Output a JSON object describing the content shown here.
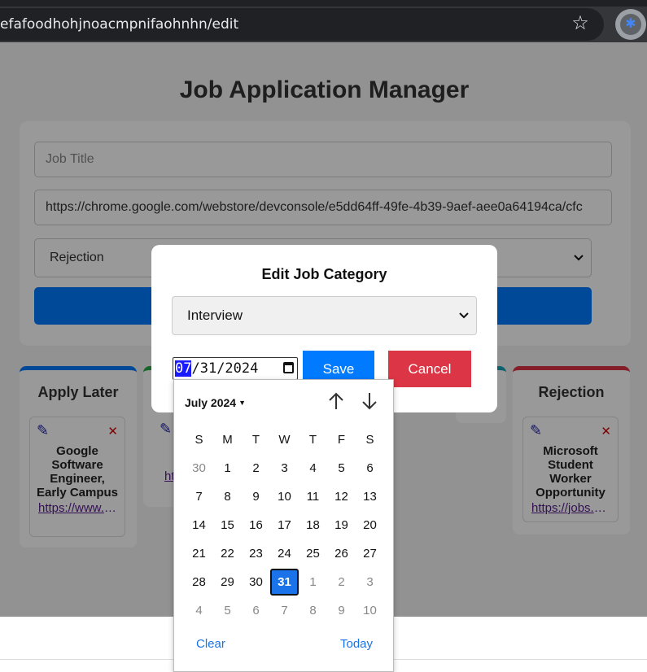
{
  "browser": {
    "url": "efafoodhohjnoacmpnifaohnhn/edit"
  },
  "page": {
    "title": "Job Application Manager",
    "form": {
      "job_title_placeholder": "Job Title",
      "url_value": "https://chrome.google.com/webstore/devconsole/e5dd64ff-49fe-4b39-9aef-aee0a64194ca/cfc",
      "category_value": "Rejection"
    },
    "columns": [
      {
        "title": "Apply Later",
        "color": "#007bff",
        "jobs": [
          {
            "name": "Google Software Engineer, Early Campus",
            "link": "https://www.google.com"
          }
        ]
      },
      {
        "title": "Rejection",
        "color": "#dc3545",
        "jobs": [
          {
            "name": "Microsoft Student Worker Opportunity",
            "link": "https://jobs.microsoft.com"
          }
        ]
      }
    ],
    "partial_column": {
      "link": "ht"
    }
  },
  "modal": {
    "title": "Edit Job Category",
    "category_value": "Interview",
    "date": {
      "month": "07",
      "rest": "/31/2024"
    },
    "save_label": "Save",
    "cancel_label": "Cancel"
  },
  "calendar": {
    "month_label": "July 2024",
    "weekdays": [
      "S",
      "M",
      "T",
      "W",
      "T",
      "F",
      "S"
    ],
    "weeks": [
      [
        {
          "d": "30",
          "dim": true
        },
        {
          "d": "1"
        },
        {
          "d": "2"
        },
        {
          "d": "3"
        },
        {
          "d": "4"
        },
        {
          "d": "5"
        },
        {
          "d": "6"
        }
      ],
      [
        {
          "d": "7"
        },
        {
          "d": "8"
        },
        {
          "d": "9"
        },
        {
          "d": "10"
        },
        {
          "d": "11"
        },
        {
          "d": "12"
        },
        {
          "d": "13"
        }
      ],
      [
        {
          "d": "14"
        },
        {
          "d": "15"
        },
        {
          "d": "16"
        },
        {
          "d": "17"
        },
        {
          "d": "18"
        },
        {
          "d": "19"
        },
        {
          "d": "20"
        }
      ],
      [
        {
          "d": "21"
        },
        {
          "d": "22"
        },
        {
          "d": "23"
        },
        {
          "d": "24"
        },
        {
          "d": "25"
        },
        {
          "d": "26"
        },
        {
          "d": "27"
        }
      ],
      [
        {
          "d": "28"
        },
        {
          "d": "29"
        },
        {
          "d": "30"
        },
        {
          "d": "31",
          "selected": true
        },
        {
          "d": "1",
          "dim": true
        },
        {
          "d": "2",
          "dim": true
        },
        {
          "d": "3",
          "dim": true
        }
      ],
      [
        {
          "d": "4",
          "dim": true
        },
        {
          "d": "5",
          "dim": true
        },
        {
          "d": "6",
          "dim": true
        },
        {
          "d": "7",
          "dim": true
        },
        {
          "d": "8",
          "dim": true
        },
        {
          "d": "9",
          "dim": true
        },
        {
          "d": "10",
          "dim": true
        }
      ]
    ],
    "clear_label": "Clear",
    "today_label": "Today"
  }
}
